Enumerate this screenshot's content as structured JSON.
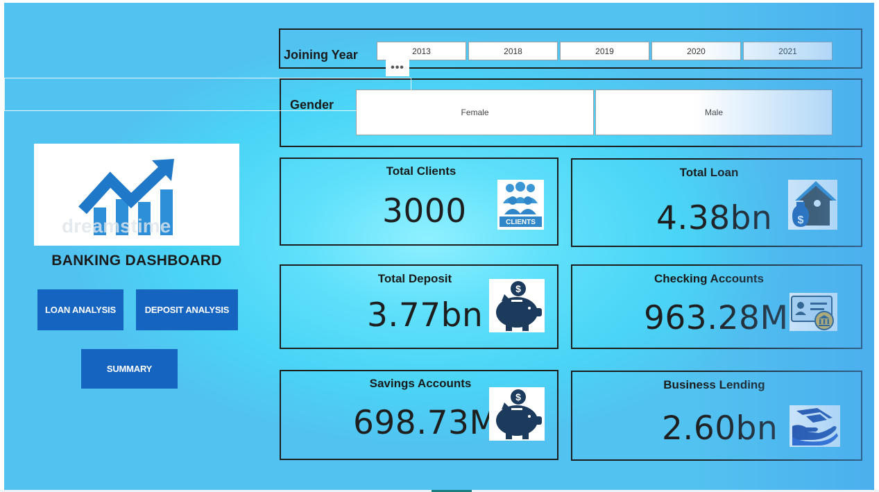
{
  "sidebar": {
    "logo_watermark": "dreamstime",
    "title": "BANKING DASHBOARD",
    "buttons": {
      "loan": "LOAN ANALYSIS",
      "deposit": "DEPOSIT ANALYSIS",
      "summary": "SUMMARY"
    }
  },
  "filters": {
    "joining_year": {
      "label": "Joining Year",
      "options": [
        "2013",
        "2018",
        "2019",
        "2020",
        "2021"
      ]
    },
    "gender": {
      "label": "Gender",
      "options": [
        "Female",
        "Male"
      ]
    },
    "more_options": "•••"
  },
  "kpis": {
    "total_clients": {
      "title": "Total Clients",
      "value": "3000",
      "icon_label": "CLIENTS"
    },
    "total_loan": {
      "title": "Total Loan",
      "value": "4.38bn"
    },
    "total_deposit": {
      "title": "Total Deposit",
      "value": "3.77bn"
    },
    "checking_accounts": {
      "title": "Checking Accounts",
      "value": "963.28M"
    },
    "savings_accounts": {
      "title": "Savings Accounts",
      "value": "698.73M"
    },
    "business_lending": {
      "title": "Business Lending",
      "value": "2.60bn"
    }
  },
  "colors": {
    "background": "#4ad4f6",
    "button": "#1565c0",
    "icon_navy": "#1b3a5c",
    "icon_blue": "#2f8fd6"
  }
}
